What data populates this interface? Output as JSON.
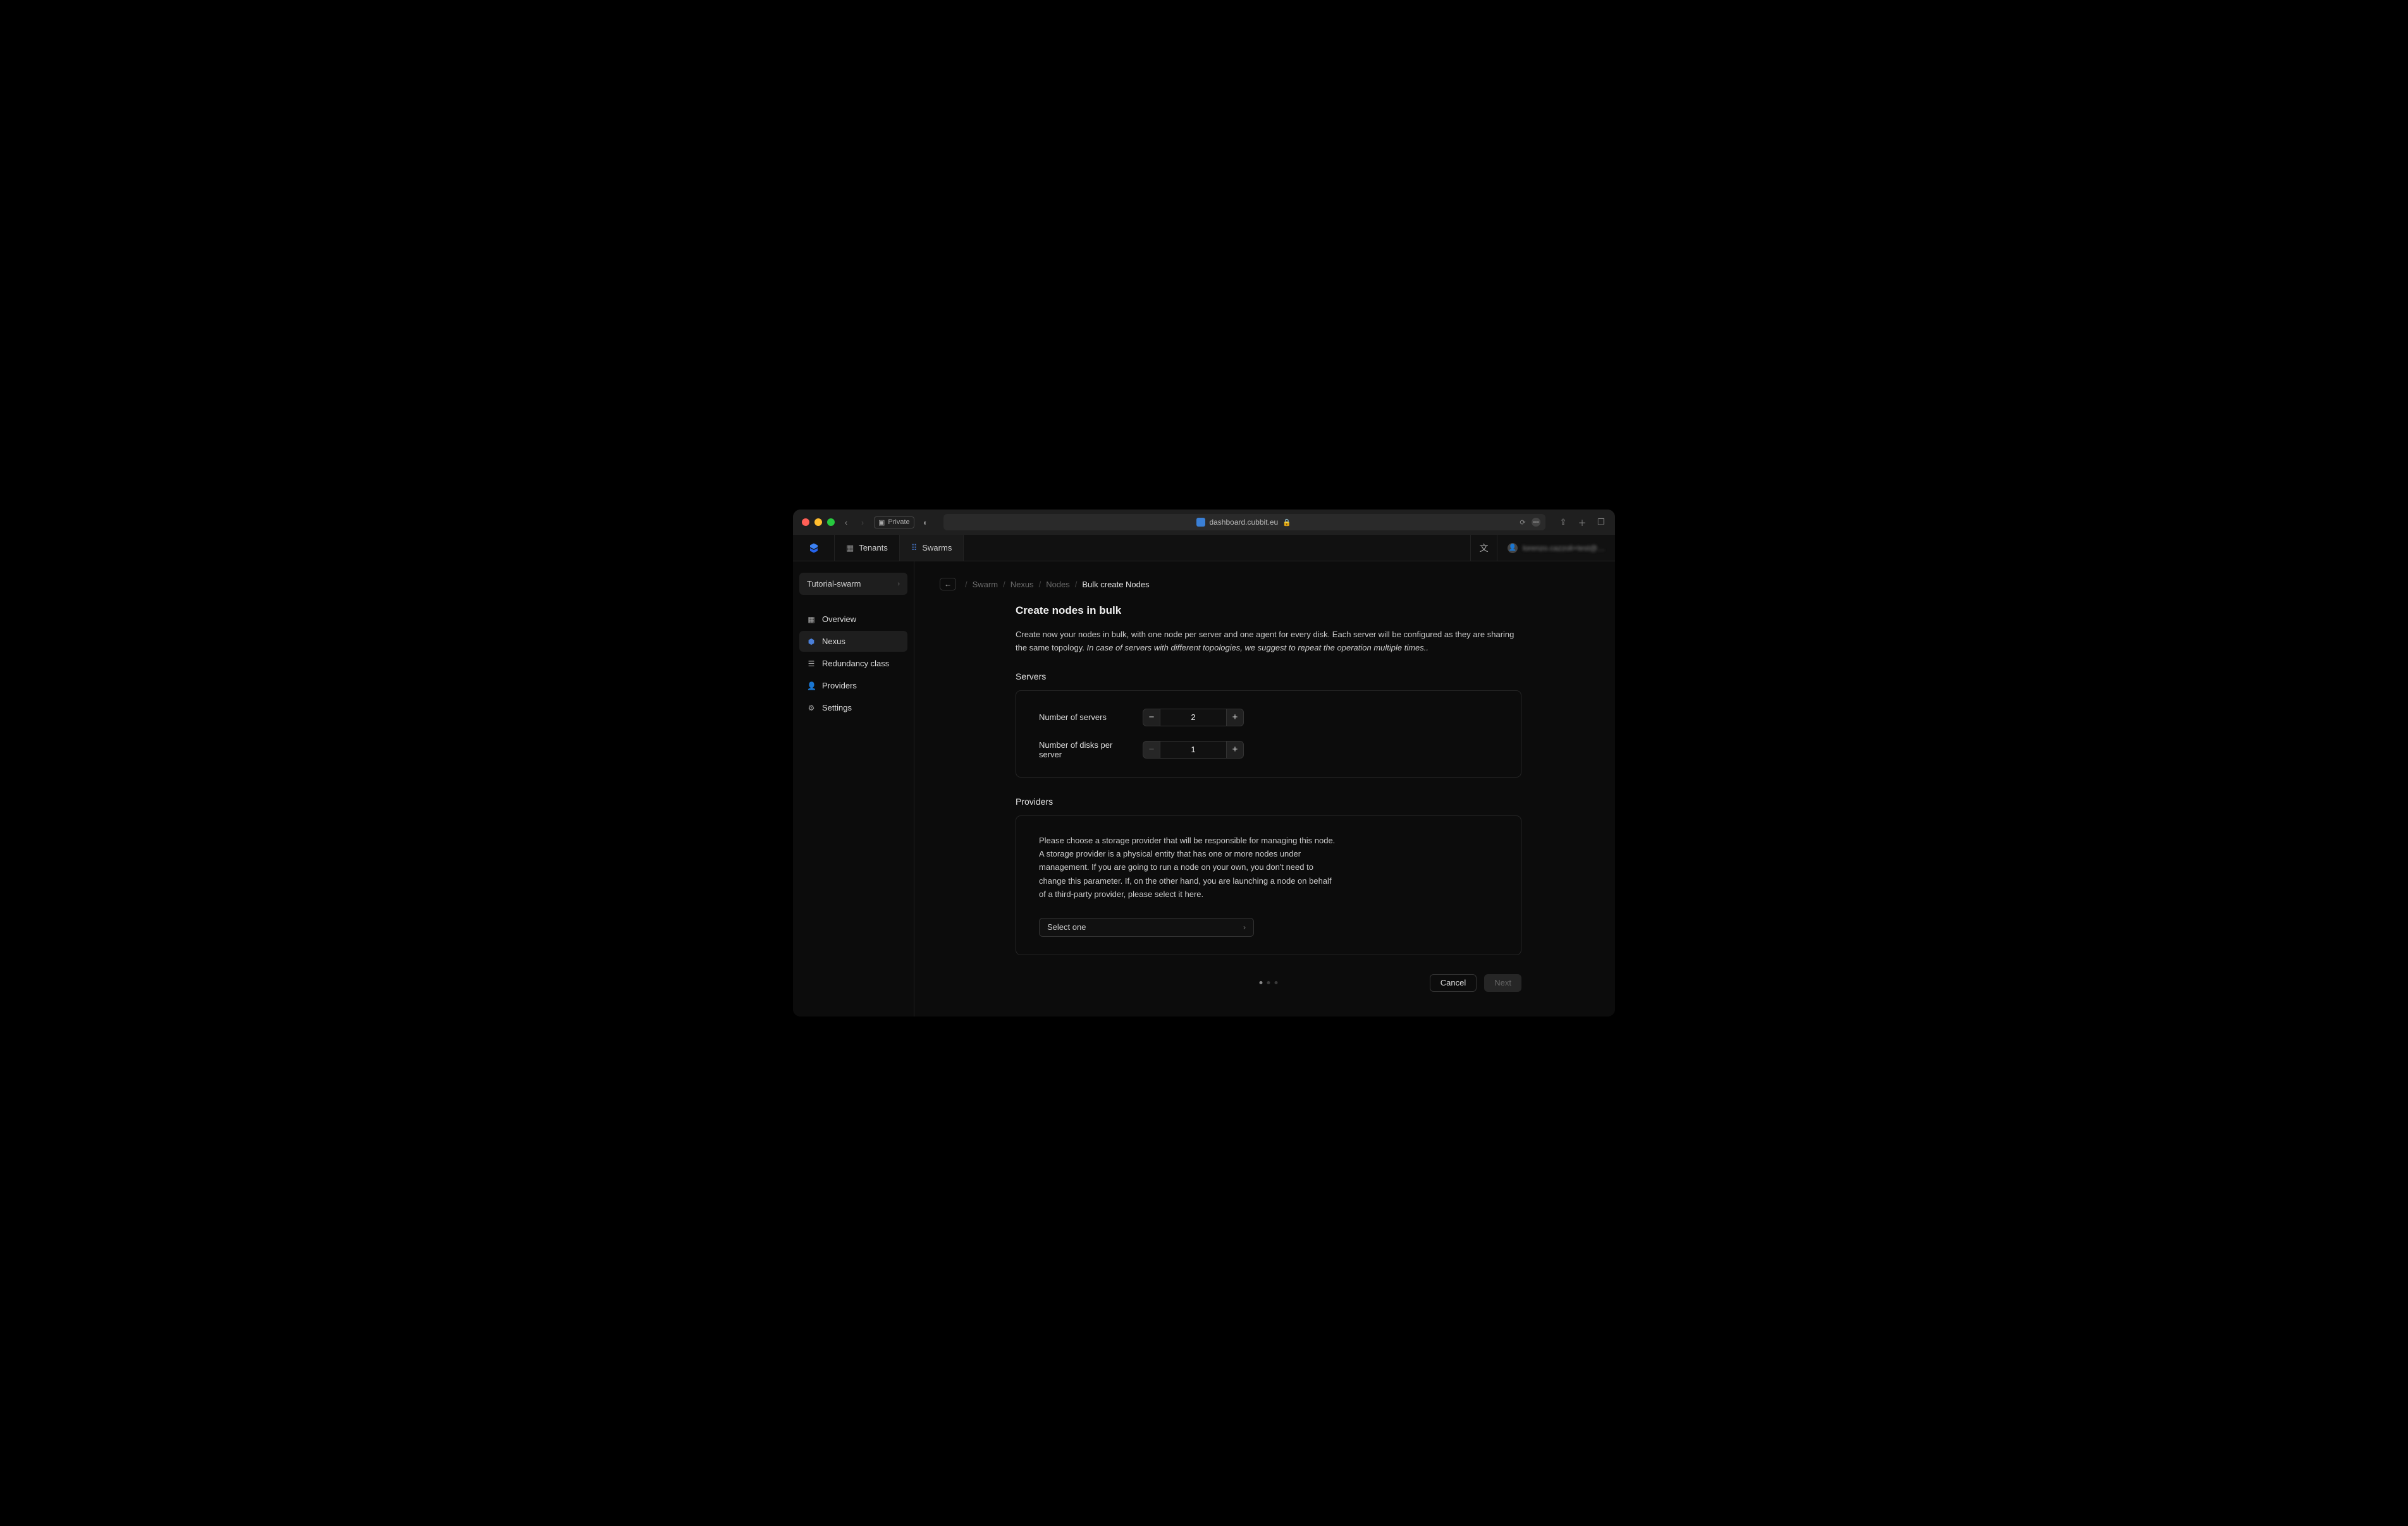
{
  "browser": {
    "private_label": "Private",
    "url": "dashboard.cubbit.eu"
  },
  "topnav": {
    "tabs": [
      {
        "label": "Tenants"
      },
      {
        "label": "Swarms"
      }
    ],
    "user": "lorenzo.cazzoli+test@…"
  },
  "sidebar": {
    "swarm_selected": "Tutorial-swarm",
    "items": [
      {
        "label": "Overview"
      },
      {
        "label": "Nexus"
      },
      {
        "label": "Redundancy class"
      },
      {
        "label": "Providers"
      },
      {
        "label": "Settings"
      }
    ]
  },
  "breadcrumbs": {
    "items": [
      "Swarm",
      "Nexus",
      "Nodes"
    ],
    "current": "Bulk create Nodes"
  },
  "page": {
    "title": "Create nodes in bulk",
    "intro_plain": "Create now your nodes in bulk, with one node per server and one agent for every disk. Each server will be configured as they are sharing the same topology. ",
    "intro_italic": "In case of servers with different topologies, we suggest to repeat the operation multiple times..",
    "servers_heading": "Servers",
    "servers": {
      "num_servers_label": "Number of servers",
      "num_servers_value": "2",
      "num_disks_label": "Number of disks per server",
      "num_disks_value": "1"
    },
    "providers_heading": "Providers",
    "providers_desc": "Please choose a storage provider that will be responsible for managing this node. A storage provider is a physical entity that has one or more nodes under management. If you are going to run a node on your own, you don't need to change this parameter. If, on the other hand, you are launching a node on behalf of a third-party provider, please select it here.",
    "provider_select_placeholder": "Select one",
    "cancel_label": "Cancel",
    "next_label": "Next"
  }
}
